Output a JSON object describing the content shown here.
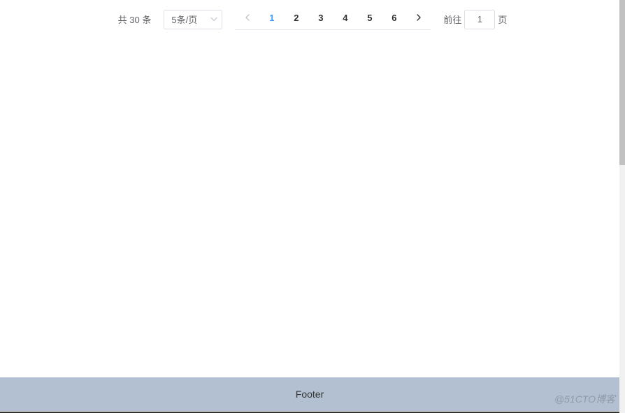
{
  "pagination": {
    "total_prefix": "共",
    "total_count": "30",
    "total_suffix": "条",
    "page_size_label": "5条/页",
    "pages": [
      "1",
      "2",
      "3",
      "4",
      "5",
      "6"
    ],
    "current_page": "1",
    "jump_prefix": "前往",
    "jump_value": "1",
    "jump_suffix": "页"
  },
  "footer": {
    "text": "Footer"
  },
  "watermark": "@51CTO博客"
}
